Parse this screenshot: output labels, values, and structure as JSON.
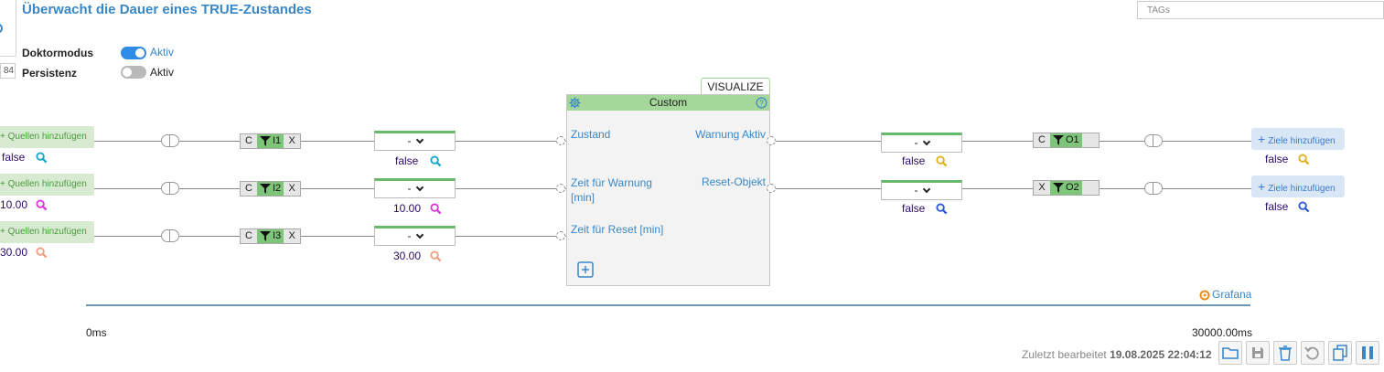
{
  "header": {
    "title": "Überwacht die Dauer eines TRUE-Zustandes",
    "side_number": "84",
    "tags_placeholder": "TAGs"
  },
  "settings": {
    "doctor_label": "Doktormodus",
    "doctor_toggle_text": "Aktiv",
    "doctor_on": true,
    "persist_label": "Persistenz",
    "persist_toggle_text": "Aktiv",
    "persist_on": false
  },
  "inputs": [
    {
      "source_label": "+ Quellen hinzufügen",
      "value": "false",
      "value_color": "#2a0a6b",
      "mag_color": "#1aa6c8",
      "filter": [
        "C",
        "I1",
        "X"
      ],
      "select": "-",
      "sel_value": "false",
      "sel_mag_color": "#1aa6c8"
    },
    {
      "source_label": "+ Quellen hinzufügen",
      "value": "10.00",
      "value_color": "#2a0a6b",
      "mag_color": "#d63ad6",
      "filter": [
        "C",
        "I2",
        "X"
      ],
      "select": "-",
      "sel_value": "10.00",
      "sel_mag_color": "#d63ad6"
    },
    {
      "source_label": "+ Quellen hinzufügen",
      "value": "30.00",
      "value_color": "#2a0a6b",
      "mag_color": "#f0a080",
      "filter": [
        "C",
        "I3",
        "X"
      ],
      "select": "-",
      "sel_value": "30.00",
      "sel_mag_color": "#f0a080"
    }
  ],
  "block": {
    "visualize_label": "VISUALIZE",
    "title": "Custom",
    "in_ports": [
      "Zustand",
      "Zeit für Warnung [min]",
      "Zeit für Reset [min]"
    ],
    "out_ports": [
      "Warnung Aktiv",
      "Reset-Objekt"
    ]
  },
  "outputs": [
    {
      "select": "-",
      "sel_value": "false",
      "sel_mag_color": "#e0b020",
      "filter": [
        "C",
        "O1"
      ],
      "target_label": "Ziele hinzufügen",
      "value": "false",
      "mag_color": "#e0b020"
    },
    {
      "select": "-",
      "sel_value": "false",
      "sel_mag_color": "#2b5bd8",
      "filter": [
        "X",
        "O2"
      ],
      "target_label": "Ziele hinzufügen",
      "value": "false",
      "mag_color": "#2b5bd8"
    }
  ],
  "timeline": {
    "grafana_label": "Grafana",
    "start": "0ms",
    "end": "30000.00ms"
  },
  "footer": {
    "last_edit_label": "Zuletzt bearbeitet",
    "last_edit_value": "19.08.2025 22:04:12",
    "buttons": [
      "folder-icon",
      "save-icon",
      "trash-icon",
      "undo-icon",
      "copy-icon",
      "pause-icon"
    ]
  },
  "colors": {
    "accent": "#3a87c8",
    "toggle_on": "#2f8be6",
    "green": "#7dc679",
    "source_bg": "#d9ead3",
    "target_bg": "#d8e6f5"
  }
}
